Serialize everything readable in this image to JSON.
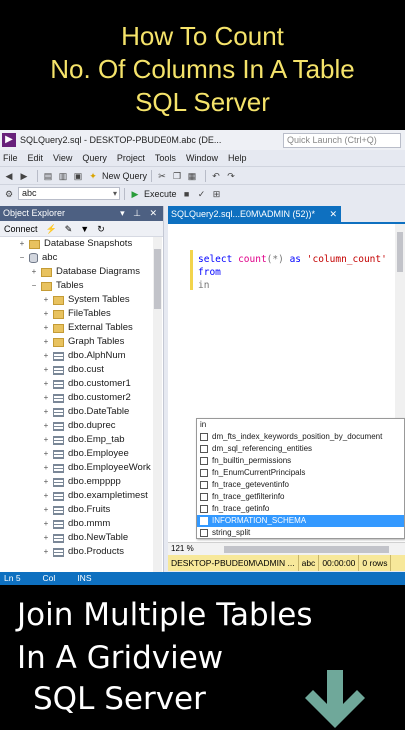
{
  "banner_top": {
    "line1": "How To Count",
    "line2": "No. Of Columns In A Table",
    "line3": "SQL Server"
  },
  "window": {
    "title": "SQLQuery2.sql - DESKTOP-PBUDE0M.abc (DE...",
    "quick_launch_placeholder": "Quick Launch (Ctrl+Q)"
  },
  "menu": [
    "File",
    "Edit",
    "View",
    "Query",
    "Project",
    "Tools",
    "Window",
    "Help"
  ],
  "toolbar": {
    "new_query": "New Query",
    "database": "abc",
    "execute": "Execute"
  },
  "object_explorer": {
    "title": "Object Explorer",
    "connect": "Connect",
    "nodes": [
      {
        "label": "Database Snapshots",
        "level": 1,
        "kind": "folder",
        "expander": "+"
      },
      {
        "label": "abc",
        "level": 1,
        "kind": "db",
        "expander": "−"
      },
      {
        "label": "Database Diagrams",
        "level": 2,
        "kind": "folder",
        "expander": "+"
      },
      {
        "label": "Tables",
        "level": 2,
        "kind": "folder",
        "expander": "−"
      },
      {
        "label": "System Tables",
        "level": 3,
        "kind": "folder",
        "expander": "+"
      },
      {
        "label": "FileTables",
        "level": 3,
        "kind": "folder",
        "expander": "+"
      },
      {
        "label": "External Tables",
        "level": 3,
        "kind": "folder",
        "expander": "+"
      },
      {
        "label": "Graph Tables",
        "level": 3,
        "kind": "folder",
        "expander": "+"
      },
      {
        "label": "dbo.AlphNum",
        "level": 3,
        "kind": "table",
        "expander": "+"
      },
      {
        "label": "dbo.cust",
        "level": 3,
        "kind": "table",
        "expander": "+"
      },
      {
        "label": "dbo.customer1",
        "level": 3,
        "kind": "table",
        "expander": "+"
      },
      {
        "label": "dbo.customer2",
        "level": 3,
        "kind": "table",
        "expander": "+"
      },
      {
        "label": "dbo.DateTable",
        "level": 3,
        "kind": "table",
        "expander": "+"
      },
      {
        "label": "dbo.duprec",
        "level": 3,
        "kind": "table",
        "expander": "+"
      },
      {
        "label": "dbo.Emp_tab",
        "level": 3,
        "kind": "table",
        "expander": "+"
      },
      {
        "label": "dbo.Employee",
        "level": 3,
        "kind": "table",
        "expander": "+"
      },
      {
        "label": "dbo.EmployeeWork",
        "level": 3,
        "kind": "table",
        "expander": "+"
      },
      {
        "label": "dbo.empppp",
        "level": 3,
        "kind": "table",
        "expander": "+"
      },
      {
        "label": "dbo.exampletimest",
        "level": 3,
        "kind": "table",
        "expander": "+"
      },
      {
        "label": "dbo.Fruits",
        "level": 3,
        "kind": "table",
        "expander": "+"
      },
      {
        "label": "dbo.mmm",
        "level": 3,
        "kind": "table",
        "expander": "+"
      },
      {
        "label": "dbo.NewTable",
        "level": 3,
        "kind": "table",
        "expander": "+"
      },
      {
        "label": "dbo.Products",
        "level": 3,
        "kind": "table",
        "expander": "+"
      }
    ]
  },
  "editor": {
    "tab_label": "SQLQuery2.sql...E0M\\ADMIN (52))*",
    "line1": {
      "k1": "select",
      "f1": "count",
      "p1": "(*)",
      "k2": "as",
      "s1": "'column_count'"
    },
    "line2": "from",
    "line3": "in"
  },
  "autocomplete": {
    "items": [
      "in",
      "dm_fts_index_keywords_position_by_document",
      "dm_sql_referencing_entities",
      "fn_builtin_permissions",
      "fn_EnumCurrentPrincipals",
      "fn_trace_geteventinfo",
      "fn_trace_getfilterinfo",
      "fn_trace_getinfo",
      "INFORMATION_SCHEMA",
      "string_split"
    ],
    "selected": "INFORMATION_SCHEMA"
  },
  "zoom": "121 %",
  "query_status": {
    "server": "DESKTOP-PBUDE0M\\ADMIN ...",
    "db": "abc",
    "time": "00:00:00",
    "rows": "0 rows"
  },
  "status": {
    "ln": "Ln 5",
    "col": "Col",
    "ins": "INS"
  },
  "banner_bottom": {
    "line1": "Join Multiple Tables",
    "line2": "In A Gridview",
    "line3": "SQL Server"
  },
  "colors": {
    "accent": "#0e70c0",
    "title_text": "#f5e36a",
    "arrow": "#6fa89a"
  }
}
